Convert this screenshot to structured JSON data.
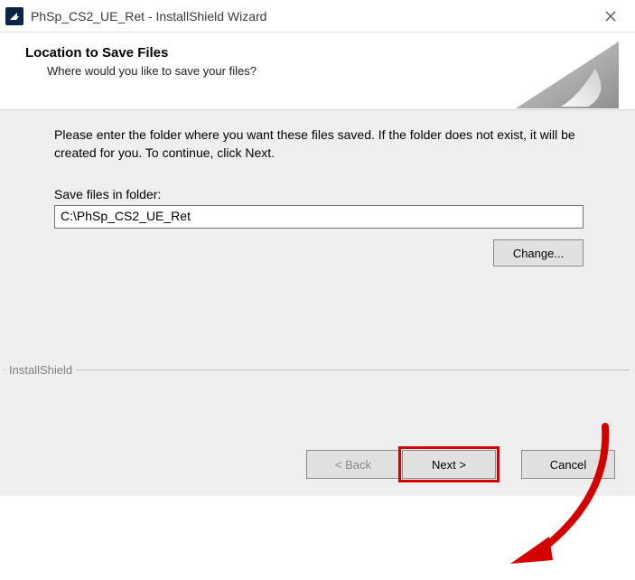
{
  "titlebar": {
    "title": "PhSp_CS2_UE_Ret - InstallShield Wizard"
  },
  "header": {
    "title": "Location to Save Files",
    "subtitle": "Where would you like to save your files?"
  },
  "content": {
    "instruction": "Please enter the folder where you want these files saved.  If the folder does not exist, it will be created for you.   To continue, click Next.",
    "field_label": "Save files in folder:",
    "folder_path": "C:\\PhSp_CS2_UE_Ret",
    "change_label": "Change..."
  },
  "footer": {
    "brand": "InstallShield",
    "back_label": "< Back",
    "next_label": "Next >",
    "cancel_label": "Cancel"
  }
}
